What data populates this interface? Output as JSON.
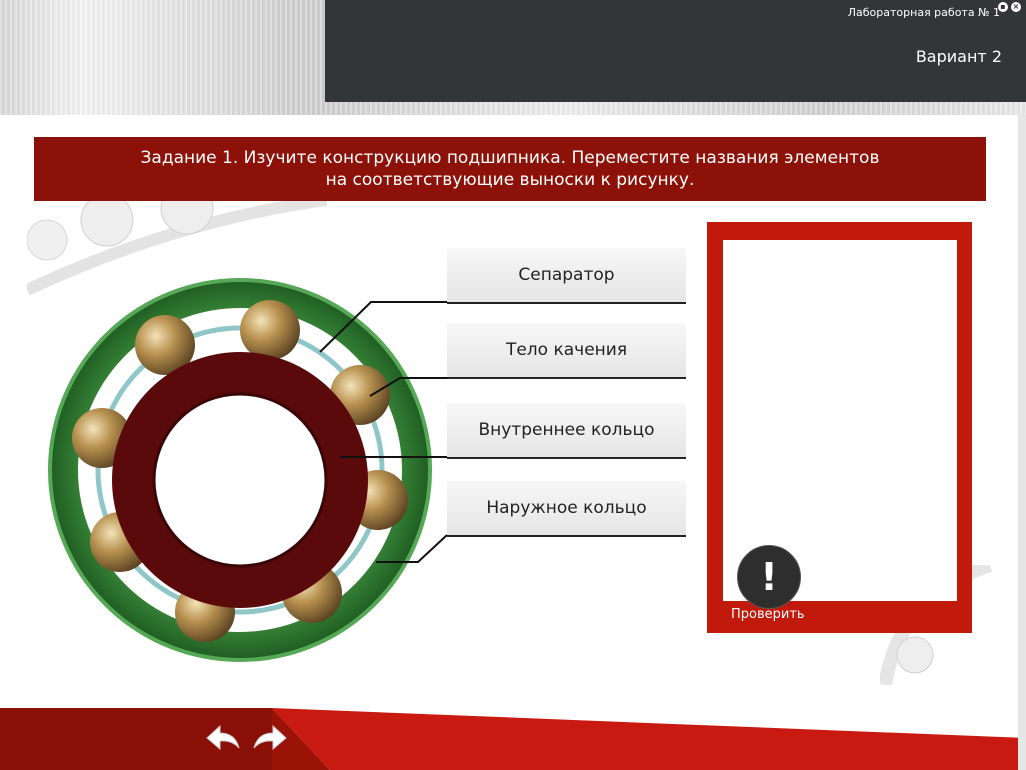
{
  "header": {
    "lab_title": "Лабораторная работа № 1",
    "variant": "Вариант 2"
  },
  "task": {
    "line1": "Задание 1. Изучите конструкцию подшипника. Переместите названия элементов",
    "line2": "на соответствующие выноски к рисунку."
  },
  "labels": [
    "Сепаратор",
    "Тело качения",
    "Внутреннее кольцо",
    "Наружное кольцо"
  ],
  "check": {
    "icon": "!",
    "label": "Проверить"
  },
  "colors": {
    "header_bg": "#333637",
    "banner": "#8c1209",
    "answer_frame": "#c1190c",
    "outer_ring": "#2e7d32",
    "inner_ring": "#5a0a0a",
    "ball": "#b8914f"
  }
}
